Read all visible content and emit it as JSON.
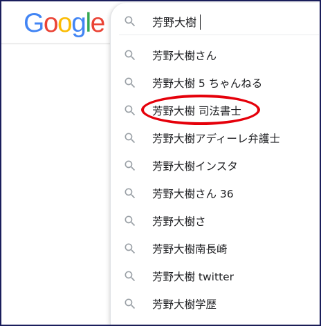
{
  "logo": {
    "letters": [
      "G",
      "o",
      "o",
      "g",
      "l",
      "e"
    ],
    "colors": [
      "#4285F4",
      "#EA4335",
      "#FBBC05",
      "#4285F4",
      "#34A853",
      "#EA4335"
    ]
  },
  "search": {
    "query": "芳野大樹",
    "icon": "search-icon"
  },
  "suggestions": [
    {
      "text": "芳野大樹さん",
      "icon": "search-icon"
    },
    {
      "text": "芳野大樹 5 ちゃんねる",
      "icon": "search-icon"
    },
    {
      "text": "芳野大樹 司法書士",
      "icon": "search-icon"
    },
    {
      "text": "芳野大樹アディーレ弁護士",
      "icon": "search-icon"
    },
    {
      "text": "芳野大樹インスタ",
      "icon": "search-icon"
    },
    {
      "text": "芳野大樹さん 36",
      "icon": "search-icon"
    },
    {
      "text": "芳野大樹さ",
      "icon": "search-icon"
    },
    {
      "text": "芳野大樹南長崎",
      "icon": "search-icon"
    },
    {
      "text": "芳野大樹 twitter",
      "icon": "search-icon"
    },
    {
      "text": "芳野大樹学歴",
      "icon": "search-icon"
    }
  ],
  "colors": {
    "icon": "#9aa0a6",
    "text": "#202124",
    "annotation": "#e5000a",
    "frame": "#1a1e5c"
  }
}
